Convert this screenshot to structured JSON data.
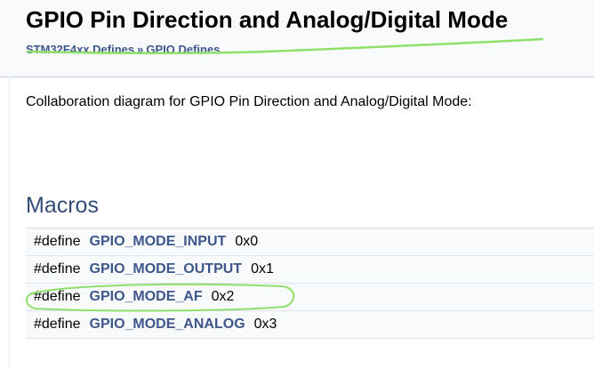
{
  "header": {
    "title": "GPIO Pin Direction and Analog/Digital Mode",
    "breadcrumb": [
      {
        "label": "STM32F4xx Defines"
      },
      {
        "label": "GPIO Defines"
      }
    ],
    "breadcrumb_separator": "»"
  },
  "main": {
    "collaboration_text": "Collaboration diagram for GPIO Pin Direction and Analog/Digital Mode:",
    "macros_heading": "Macros",
    "macros": [
      {
        "keyword": "#define",
        "name": "GPIO_MODE_INPUT",
        "value": "0x0"
      },
      {
        "keyword": "#define",
        "name": "GPIO_MODE_OUTPUT",
        "value": "0x1"
      },
      {
        "keyword": "#define",
        "name": "GPIO_MODE_AF",
        "value": "0x2"
      },
      {
        "keyword": "#define",
        "name": "GPIO_MODE_ANALOG",
        "value": "0x3"
      }
    ]
  },
  "colors": {
    "link": "#3d578c",
    "heading": "#354c7b",
    "highlight_stroke": "#8ee06a"
  }
}
